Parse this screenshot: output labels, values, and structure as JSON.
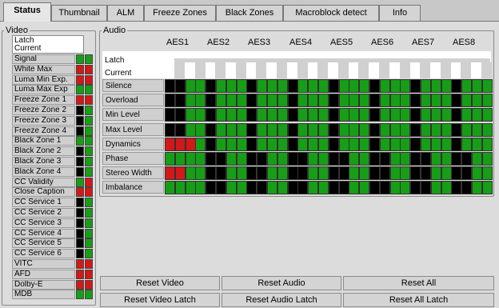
{
  "tabs": [
    {
      "label": "Status",
      "active": true
    },
    {
      "label": "Thumbnail",
      "active": false
    },
    {
      "label": "ALM",
      "active": false
    },
    {
      "label": "Freeze Zones",
      "active": false
    },
    {
      "label": "Black Zones",
      "active": false
    },
    {
      "label": "Macroblock detect",
      "active": false
    },
    {
      "label": "Info",
      "active": false
    }
  ],
  "video": {
    "legend": "Video",
    "latch_label": "Latch",
    "current_label": "Current",
    "rows": [
      {
        "label": "Signal",
        "latch": "green",
        "current": "green"
      },
      {
        "label": "White Max",
        "latch": "red",
        "current": "red"
      },
      {
        "label": "Luma Min Exp.",
        "latch": "red",
        "current": "red"
      },
      {
        "label": "Luma Max Exp",
        "latch": "green",
        "current": "green"
      },
      {
        "label": "Freeze Zone 1",
        "latch": "red",
        "current": "red"
      },
      {
        "label": "Freeze Zone 2",
        "latch": "black",
        "current": "green"
      },
      {
        "label": "Freeze Zone 3",
        "latch": "black",
        "current": "green"
      },
      {
        "label": "Freeze Zone 4",
        "latch": "black",
        "current": "green"
      },
      {
        "label": "Black Zone 1",
        "latch": "green",
        "current": "green"
      },
      {
        "label": "Black Zone 2",
        "latch": "black",
        "current": "green"
      },
      {
        "label": "Black Zone 3",
        "latch": "black",
        "current": "green"
      },
      {
        "label": "Black Zone 4",
        "latch": "black",
        "current": "green"
      },
      {
        "label": "CC Validity",
        "latch": "green",
        "current": "red"
      },
      {
        "label": "Close Caption",
        "latch": "red",
        "current": "red"
      },
      {
        "label": "CC Service 1",
        "latch": "black",
        "current": "green"
      },
      {
        "label": "CC Service 2",
        "latch": "black",
        "current": "green"
      },
      {
        "label": "CC Service 3",
        "latch": "black",
        "current": "green"
      },
      {
        "label": "CC Service 4",
        "latch": "black",
        "current": "green"
      },
      {
        "label": "CC Service 5",
        "latch": "black",
        "current": "green"
      },
      {
        "label": "CC Service 6",
        "latch": "black",
        "current": "green"
      },
      {
        "label": "VITC",
        "latch": "red",
        "current": "red"
      },
      {
        "label": "AFD",
        "latch": "red",
        "current": "red"
      },
      {
        "label": "Dolby-E",
        "latch": "red",
        "current": "red"
      },
      {
        "label": "MDB",
        "latch": "green",
        "current": "green"
      }
    ]
  },
  "audio": {
    "legend": "Audio",
    "aes_labels": [
      "AES1",
      "AES2",
      "AES3",
      "AES4",
      "AES5",
      "AES6",
      "AES7",
      "AES8"
    ],
    "latch_label": "Latch",
    "current_label": "Current",
    "rows": [
      {
        "label": "Silence",
        "cells": [
          "black",
          "black",
          "green",
          "green",
          "black",
          "green",
          "green",
          "green",
          "black",
          "green",
          "green",
          "green",
          "black",
          "green",
          "green",
          "green",
          "black",
          "green",
          "green",
          "green",
          "black",
          "green",
          "green",
          "green",
          "black",
          "green",
          "green",
          "green",
          "black",
          "green",
          "green",
          "green"
        ]
      },
      {
        "label": "Overload",
        "cells": [
          "black",
          "black",
          "green",
          "green",
          "black",
          "green",
          "green",
          "green",
          "black",
          "green",
          "green",
          "green",
          "black",
          "green",
          "green",
          "green",
          "black",
          "green",
          "green",
          "green",
          "black",
          "green",
          "green",
          "green",
          "black",
          "green",
          "green",
          "green",
          "black",
          "green",
          "green",
          "green"
        ]
      },
      {
        "label": "Min Level",
        "cells": [
          "black",
          "black",
          "green",
          "green",
          "black",
          "green",
          "green",
          "green",
          "black",
          "green",
          "green",
          "green",
          "black",
          "green",
          "green",
          "green",
          "black",
          "green",
          "green",
          "green",
          "black",
          "green",
          "green",
          "green",
          "black",
          "green",
          "green",
          "green",
          "black",
          "green",
          "green",
          "green"
        ]
      },
      {
        "label": "Max Level",
        "cells": [
          "black",
          "black",
          "green",
          "green",
          "black",
          "green",
          "green",
          "green",
          "black",
          "green",
          "green",
          "green",
          "black",
          "green",
          "green",
          "green",
          "black",
          "green",
          "green",
          "green",
          "black",
          "green",
          "green",
          "green",
          "black",
          "green",
          "green",
          "green",
          "black",
          "green",
          "green",
          "green"
        ]
      },
      {
        "label": "Dynamics",
        "cells": [
          "red",
          "red",
          "red",
          "green",
          "black",
          "green",
          "green",
          "green",
          "black",
          "green",
          "green",
          "green",
          "black",
          "green",
          "green",
          "green",
          "black",
          "green",
          "green",
          "green",
          "black",
          "green",
          "green",
          "green",
          "black",
          "green",
          "green",
          "green",
          "black",
          "green",
          "green",
          "green"
        ]
      },
      {
        "label": "Phase",
        "cells": [
          "green",
          "green",
          "green",
          "green",
          "black",
          "black",
          "green",
          "green",
          "black",
          "black",
          "green",
          "green",
          "black",
          "black",
          "green",
          "green",
          "black",
          "black",
          "green",
          "green",
          "black",
          "black",
          "green",
          "green",
          "black",
          "black",
          "green",
          "green",
          "black",
          "black",
          "green",
          "green"
        ]
      },
      {
        "label": "Stereo Width",
        "cells": [
          "red",
          "red",
          "green",
          "green",
          "black",
          "black",
          "green",
          "green",
          "black",
          "black",
          "green",
          "green",
          "black",
          "black",
          "green",
          "green",
          "black",
          "black",
          "green",
          "green",
          "black",
          "black",
          "green",
          "green",
          "black",
          "black",
          "green",
          "green",
          "black",
          "black",
          "green",
          "green"
        ]
      },
      {
        "label": "Imbalance",
        "cells": [
          "green",
          "green",
          "green",
          "green",
          "black",
          "black",
          "green",
          "green",
          "black",
          "black",
          "green",
          "green",
          "black",
          "black",
          "green",
          "green",
          "black",
          "black",
          "green",
          "green",
          "black",
          "black",
          "green",
          "green",
          "black",
          "black",
          "green",
          "green",
          "black",
          "black",
          "green",
          "green"
        ]
      }
    ]
  },
  "buttons": {
    "reset_video": "Reset Video",
    "reset_audio": "Reset Audio",
    "reset_all": "Reset All",
    "reset_video_latch": "Reset Video Latch",
    "reset_audio_latch": "Reset Audio Latch",
    "reset_all_latch": "Reset All Latch"
  },
  "colors": {
    "green": "#169e16",
    "black": "#000000",
    "red": "#d21818"
  }
}
